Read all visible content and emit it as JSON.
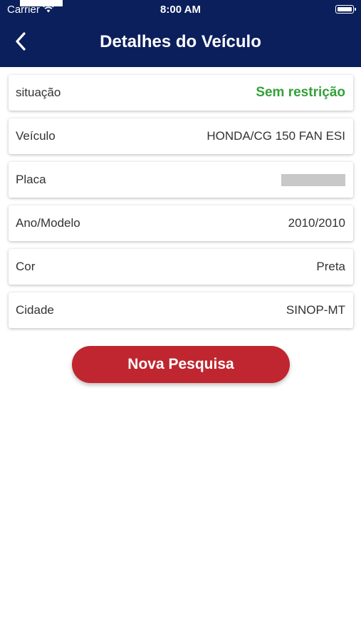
{
  "status_bar": {
    "carrier": "Carrier",
    "time": "8:00 AM",
    "wifi_icon": "wifi-icon",
    "battery_icon": "battery-icon"
  },
  "nav": {
    "title": "Detalhes do Veículo",
    "back_icon": "chevron-left-icon"
  },
  "details": [
    {
      "label": "situação",
      "value": "Sem restrição",
      "kind": "status"
    },
    {
      "label": "Veículo",
      "value": "HONDA/CG 150 FAN ESI",
      "kind": "text"
    },
    {
      "label": "Placa",
      "value": "",
      "kind": "redacted"
    },
    {
      "label": "Ano/Modelo",
      "value": "2010/2010",
      "kind": "text"
    },
    {
      "label": "Cor",
      "value": "Preta",
      "kind": "text"
    },
    {
      "label": "Cidade",
      "value": "SINOP-MT",
      "kind": "text"
    }
  ],
  "actions": {
    "new_search_label": "Nova Pesquisa"
  },
  "colors": {
    "header_bg": "#0b1f5c",
    "status_ok": "#34a13a",
    "button_bg": "#c0262f",
    "redaction": "#c8c8c8"
  }
}
